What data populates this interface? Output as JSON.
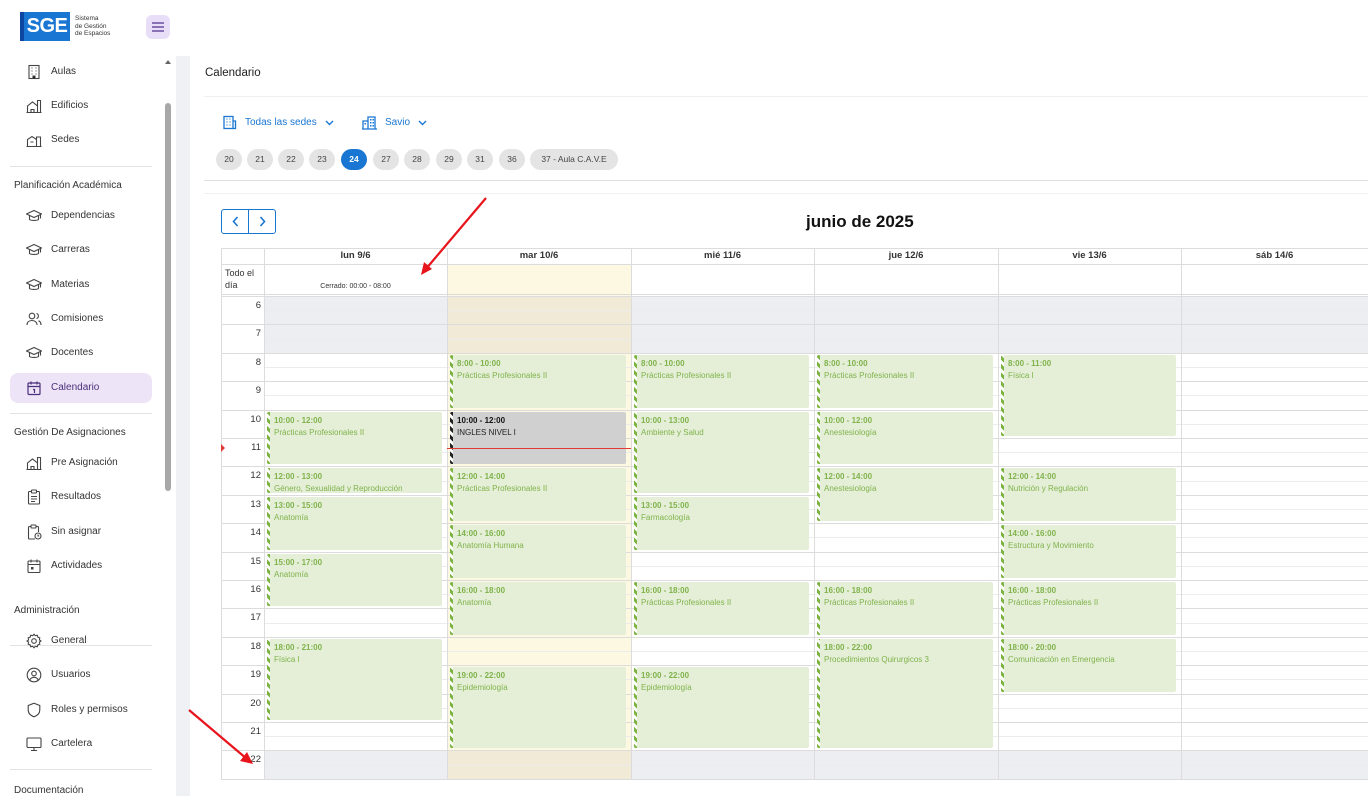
{
  "logo": {
    "brand": "SGE",
    "subtitle_lines": [
      "Sistema",
      "de Gestión",
      "de Espacios"
    ]
  },
  "sidebar": {
    "top_items": [
      {
        "label": "Aulas",
        "icon": "building-icon"
      },
      {
        "label": "Edificios",
        "icon": "buildings-icon"
      },
      {
        "label": "Sedes",
        "icon": "campus-icon"
      }
    ],
    "sections": [
      {
        "title": "Planificación Académica",
        "items": [
          {
            "label": "Dependencias",
            "icon": "graduation-cap-icon"
          },
          {
            "label": "Carreras",
            "icon": "graduation-cap-icon"
          },
          {
            "label": "Materias",
            "icon": "graduation-cap-icon"
          },
          {
            "label": "Comisiones",
            "icon": "users-icon"
          },
          {
            "label": "Docentes",
            "icon": "graduation-cap-icon"
          },
          {
            "label": "Calendario",
            "icon": "calendar-icon",
            "active": true
          }
        ]
      },
      {
        "title": "Gestión De Asignaciones",
        "items": [
          {
            "label": "Pre Asignación",
            "icon": "buildings-icon"
          },
          {
            "label": "Resultados",
            "icon": "clipboard-list-icon"
          },
          {
            "label": "Sin asignar",
            "icon": "clipboard-clock-icon"
          },
          {
            "label": "Actividades",
            "icon": "calendar-event-icon"
          }
        ]
      },
      {
        "title": "Administración",
        "items": [
          {
            "label": "General",
            "icon": "gear-icon"
          },
          {
            "label": "Usuarios",
            "icon": "user-circle-icon"
          },
          {
            "label": "Roles y permisos",
            "icon": "shield-icon"
          },
          {
            "label": "Cartelera",
            "icon": "monitor-icon"
          }
        ]
      },
      {
        "title": "Documentación",
        "items": []
      }
    ]
  },
  "main": {
    "title": "Calendario",
    "filters": {
      "sede": "Todas las sedes",
      "edificio": "Savio"
    },
    "chips": [
      "20",
      "21",
      "22",
      "23",
      "24",
      "27",
      "28",
      "29",
      "31",
      "36",
      "37 - Aula C.A.V.E"
    ],
    "selected_chip": "24"
  },
  "calendar": {
    "title": "junio de 2025",
    "all_day_label": "Todo el día",
    "days": [
      "lun 9/6",
      "mar 10/6",
      "mié 11/6",
      "jue 12/6",
      "vie 13/6",
      "sáb 14/6"
    ],
    "today_index": 1,
    "hours": [
      "6",
      "7",
      "8",
      "9",
      "10",
      "11",
      "12",
      "13",
      "14",
      "15",
      "16",
      "17",
      "18",
      "19",
      "20",
      "21",
      "22"
    ],
    "closed_label": "Cerrado: 00:00 - 08:00",
    "events": [
      {
        "day": 0,
        "start": 10,
        "end": 12,
        "time": "10:00 - 12:00",
        "name": "Prácticas Profesionales II"
      },
      {
        "day": 0,
        "start": 12,
        "end": 13,
        "time": "12:00 - 13:00",
        "name": "Género, Sexualidad y Reproducción"
      },
      {
        "day": 0,
        "start": 13,
        "end": 15,
        "time": "13:00 - 15:00",
        "name": "Anatomía"
      },
      {
        "day": 0,
        "start": 15,
        "end": 17,
        "time": "15:00 - 17:00",
        "name": "Anatomía"
      },
      {
        "day": 0,
        "start": 18,
        "end": 21,
        "time": "18:00 - 21:00",
        "name": "Física I"
      },
      {
        "day": 1,
        "start": 8,
        "end": 10,
        "time": "8:00 - 10:00",
        "name": "Prácticas Profesionales II"
      },
      {
        "day": 1,
        "start": 10,
        "end": 12,
        "time": "10:00 - 12:00",
        "name": "INGLES NIVEL I",
        "style": "gray"
      },
      {
        "day": 1,
        "start": 12,
        "end": 14,
        "time": "12:00 - 14:00",
        "name": "Prácticas Profesionales II"
      },
      {
        "day": 1,
        "start": 14,
        "end": 16,
        "time": "14:00 - 16:00",
        "name": "Anatomía Humana"
      },
      {
        "day": 1,
        "start": 16,
        "end": 18,
        "time": "16:00 - 18:00",
        "name": "Anatomía"
      },
      {
        "day": 1,
        "start": 19,
        "end": 22,
        "time": "19:00 - 22:00",
        "name": "Epidemiología"
      },
      {
        "day": 2,
        "start": 8,
        "end": 10,
        "time": "8:00 - 10:00",
        "name": "Prácticas Profesionales II"
      },
      {
        "day": 2,
        "start": 10,
        "end": 13,
        "time": "10:00 - 13:00",
        "name": "Ambiente y Salud"
      },
      {
        "day": 2,
        "start": 13,
        "end": 15,
        "time": "13:00 - 15:00",
        "name": "Farmacología"
      },
      {
        "day": 2,
        "start": 16,
        "end": 18,
        "time": "16:00 - 18:00",
        "name": "Prácticas Profesionales II"
      },
      {
        "day": 2,
        "start": 19,
        "end": 22,
        "time": "19:00 - 22:00",
        "name": "Epidemiología"
      },
      {
        "day": 3,
        "start": 8,
        "end": 10,
        "time": "8:00 - 10:00",
        "name": "Prácticas Profesionales II"
      },
      {
        "day": 3,
        "start": 10,
        "end": 12,
        "time": "10:00 - 12:00",
        "name": "Anestesiología"
      },
      {
        "day": 3,
        "start": 12,
        "end": 14,
        "time": "12:00 - 14:00",
        "name": "Anestesiología"
      },
      {
        "day": 3,
        "start": 16,
        "end": 18,
        "time": "16:00 - 18:00",
        "name": "Prácticas Profesionales II"
      },
      {
        "day": 3,
        "start": 18,
        "end": 22,
        "time": "18:00 - 22:00",
        "name": "Procedimientos Quirurgicos 3"
      },
      {
        "day": 4,
        "start": 8,
        "end": 11,
        "time": "8:00 - 11:00",
        "name": "Física I"
      },
      {
        "day": 4,
        "start": 12,
        "end": 14,
        "time": "12:00 - 14:00",
        "name": "Nutrición y Regulación"
      },
      {
        "day": 4,
        "start": 14,
        "end": 16,
        "time": "14:00 - 16:00",
        "name": "Estructura y Movimiento"
      },
      {
        "day": 4,
        "start": 16,
        "end": 18,
        "time": "16:00 - 18:00",
        "name": "Prácticas Profesionales II"
      },
      {
        "day": 4,
        "start": 18,
        "end": 20,
        "time": "18:00 - 20:00",
        "name": "Comunicación en Emergencia"
      }
    ]
  },
  "colors": {
    "primary": "#1976d2",
    "event_bg": "#e5efd8",
    "event_text": "#7fb24a",
    "today_bg": "#fdf8e1",
    "closed_bg": "#eceef1",
    "now_line": "#e53935",
    "annotation": "#e8141c"
  }
}
